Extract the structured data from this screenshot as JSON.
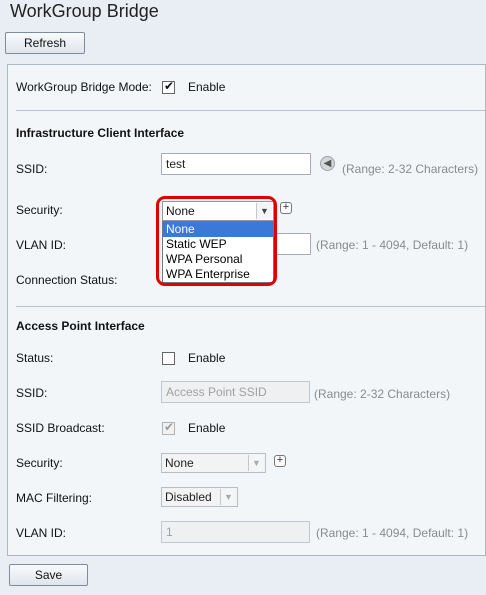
{
  "page": {
    "title": "WorkGroup Bridge",
    "refresh_label": "Refresh",
    "save_label": "Save"
  },
  "wgb_mode": {
    "label": "WorkGroup Bridge Mode:",
    "checked": true,
    "enable_label": "Enable"
  },
  "infrastructure": {
    "title": "Infrastructure Client Interface",
    "ssid_label": "SSID:",
    "ssid_value": "test",
    "ssid_hint": "(Range: 2-32 Characters)",
    "security_label": "Security:",
    "security_value": "None",
    "security_options": [
      "None",
      "Static WEP",
      "WPA Personal",
      "WPA Enterprise"
    ],
    "vlan_label": "VLAN ID:",
    "vlan_hint": "(Range: 1 - 4094, Default: 1)",
    "connection_label": "Connection Status:"
  },
  "access_point": {
    "title": "Access Point Interface",
    "status_label": "Status:",
    "status_checked": false,
    "status_enable_label": "Enable",
    "ssid_label": "SSID:",
    "ssid_placeholder": "Access Point SSID",
    "ssid_hint": "(Range: 2-32 Characters)",
    "broadcast_label": "SSID Broadcast:",
    "broadcast_checked": true,
    "broadcast_enable_label": "Enable",
    "security_label": "Security:",
    "security_value": "None",
    "mac_label": "MAC Filtering:",
    "mac_value": "Disabled",
    "vlan_label": "VLAN ID:",
    "vlan_value": "1",
    "vlan_hint": "(Range: 1 - 4094, Default: 1)"
  },
  "icons": {
    "ssid_scan": "circle-arrow-left-icon",
    "security_add": "plus-icon",
    "ap_security_add": "plus-icon"
  },
  "colors": {
    "highlight": "#e00000",
    "selected_option": "#3b78d8"
  }
}
